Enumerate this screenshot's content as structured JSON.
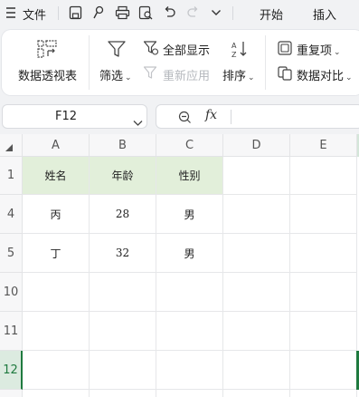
{
  "menubar": {
    "menu_icon": "hamburger-icon",
    "file_label": "文件",
    "tabs": [
      "开始",
      "插入"
    ],
    "quick_icons": [
      "save-icon",
      "brush-icon",
      "print-icon",
      "preview-icon",
      "undo-icon",
      "redo-icon",
      "chevron-down-icon"
    ]
  },
  "ribbon": {
    "pivot_label": "数据透视表",
    "filter_label": "筛选",
    "show_all_label": "全部显示",
    "reapply_label": "重新应用",
    "sort_label": "排序",
    "duplicate_label": "重复项",
    "compare_label": "数据对比"
  },
  "formula_bar": {
    "name_box": "F12",
    "fx_label": "fx",
    "value": ""
  },
  "sheet": {
    "columns": [
      "A",
      "B",
      "C",
      "D",
      "E"
    ],
    "rows": [
      {
        "num": "1",
        "cells": [
          "姓名",
          "年龄",
          "性别",
          "",
          ""
        ]
      },
      {
        "num": "4",
        "cells": [
          "丙",
          "28",
          "男",
          "",
          ""
        ]
      },
      {
        "num": "5",
        "cells": [
          "丁",
          "32",
          "男",
          "",
          ""
        ]
      },
      {
        "num": "10",
        "cells": [
          "",
          "",
          "",
          "",
          ""
        ]
      },
      {
        "num": "11",
        "cells": [
          "",
          "",
          "",
          "",
          ""
        ]
      },
      {
        "num": "12",
        "cells": [
          "",
          "",
          "",
          "",
          ""
        ]
      }
    ],
    "header_fill": "#e2efda",
    "selection_color": "#1f7a3f"
  }
}
